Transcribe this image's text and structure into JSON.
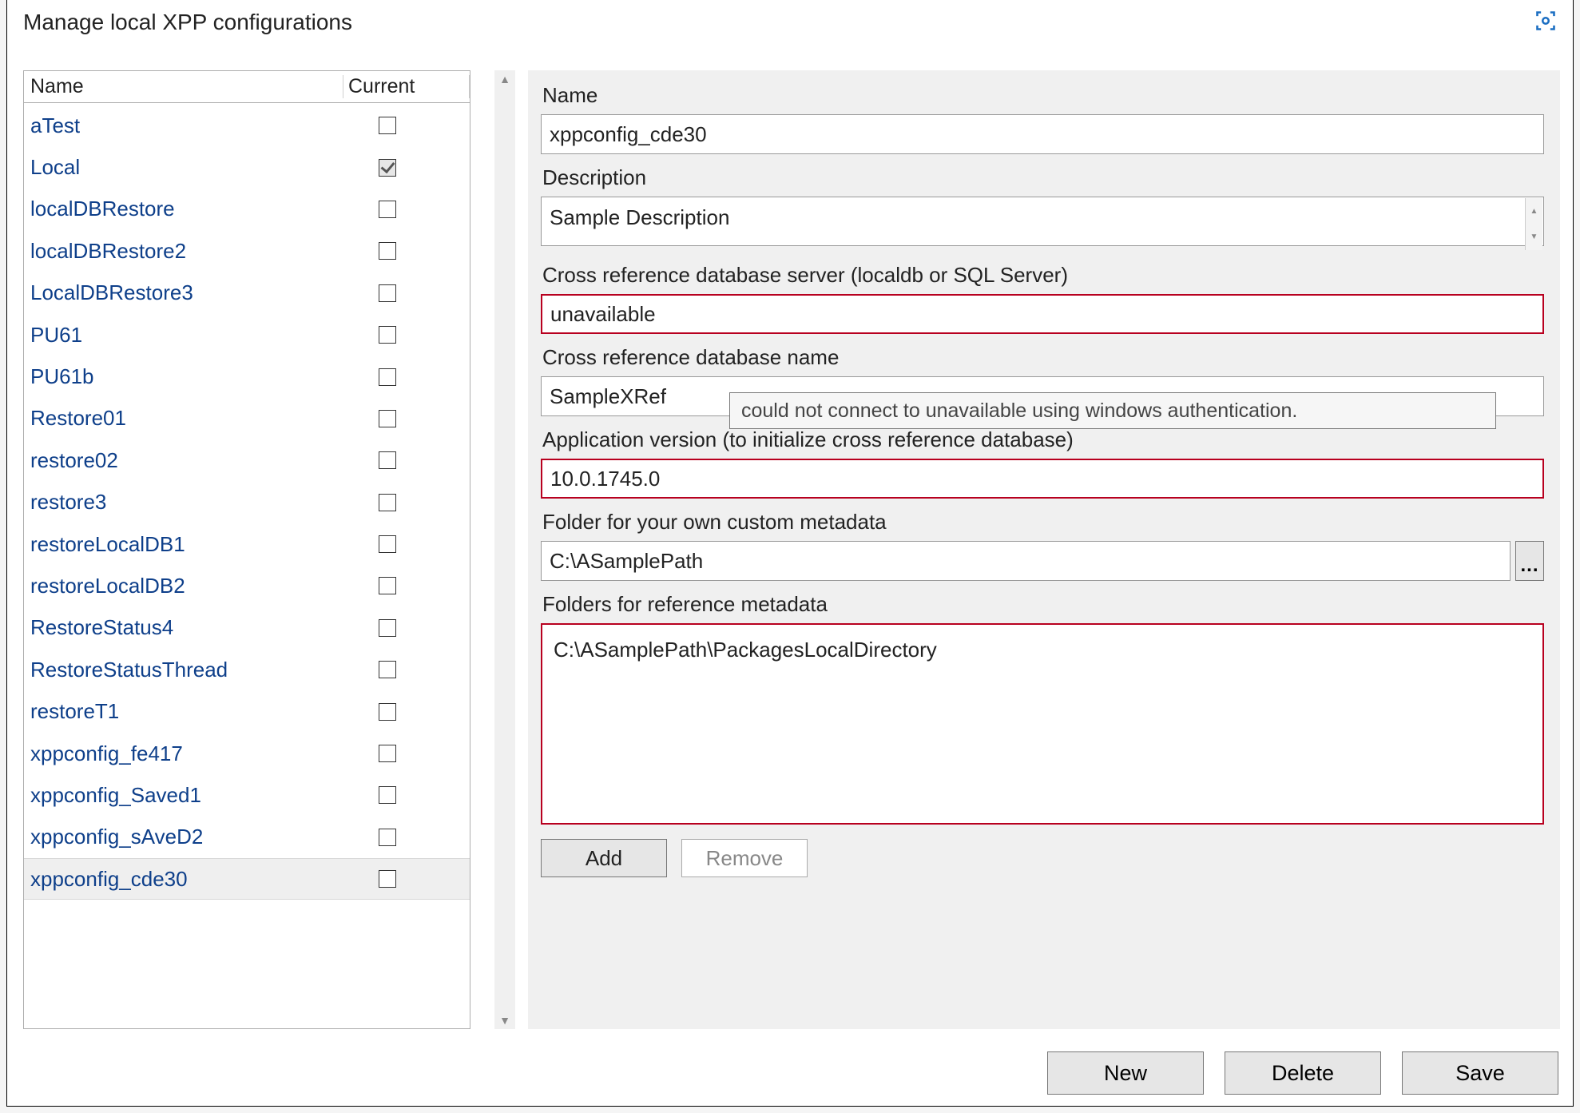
{
  "window": {
    "title": "Manage local XPP configurations"
  },
  "list": {
    "header_name": "Name",
    "header_current": "Current",
    "rows": [
      {
        "name": "aTest",
        "checked": false,
        "selected": false
      },
      {
        "name": "Local",
        "checked": true,
        "selected": false
      },
      {
        "name": "localDBRestore",
        "checked": false,
        "selected": false
      },
      {
        "name": "localDBRestore2",
        "checked": false,
        "selected": false
      },
      {
        "name": "LocalDBRestore3",
        "checked": false,
        "selected": false
      },
      {
        "name": "PU61",
        "checked": false,
        "selected": false
      },
      {
        "name": "PU61b",
        "checked": false,
        "selected": false
      },
      {
        "name": "Restore01",
        "checked": false,
        "selected": false
      },
      {
        "name": "restore02",
        "checked": false,
        "selected": false
      },
      {
        "name": "restore3",
        "checked": false,
        "selected": false
      },
      {
        "name": "restoreLocalDB1",
        "checked": false,
        "selected": false
      },
      {
        "name": "restoreLocalDB2",
        "checked": false,
        "selected": false
      },
      {
        "name": "RestoreStatus4",
        "checked": false,
        "selected": false
      },
      {
        "name": "RestoreStatusThread",
        "checked": false,
        "selected": false
      },
      {
        "name": "restoreT1",
        "checked": false,
        "selected": false
      },
      {
        "name": "xppconfig_fe417",
        "checked": false,
        "selected": false
      },
      {
        "name": "xppconfig_Saved1",
        "checked": false,
        "selected": false
      },
      {
        "name": "xppconfig_sAveD2",
        "checked": false,
        "selected": false
      },
      {
        "name": "xppconfig_cde30",
        "checked": false,
        "selected": true
      }
    ]
  },
  "form": {
    "name_label": "Name",
    "name_value": "xppconfig_cde30",
    "desc_label": "Description",
    "desc_value": "Sample Description",
    "xref_server_label": "Cross reference database server (localdb or SQL Server)",
    "xref_server_value": "unavailable",
    "xref_db_label": "Cross reference database name",
    "xref_db_value": "SampleXRef",
    "app_version_label": "Application version (to initialize cross reference database)",
    "app_version_value": "10.0.1745.0",
    "custom_meta_label": "Folder for your own custom metadata",
    "custom_meta_value": "C:\\ASamplePath",
    "ref_meta_label": "Folders for reference metadata",
    "ref_meta_item": "C:\\ASamplePath\\PackagesLocalDirectory",
    "browse_label": "...",
    "add_label": "Add",
    "remove_label": "Remove"
  },
  "tooltip": {
    "text": "could not connect to unavailable using windows authentication."
  },
  "footer": {
    "new_label": "New",
    "delete_label": "Delete",
    "save_label": "Save"
  }
}
